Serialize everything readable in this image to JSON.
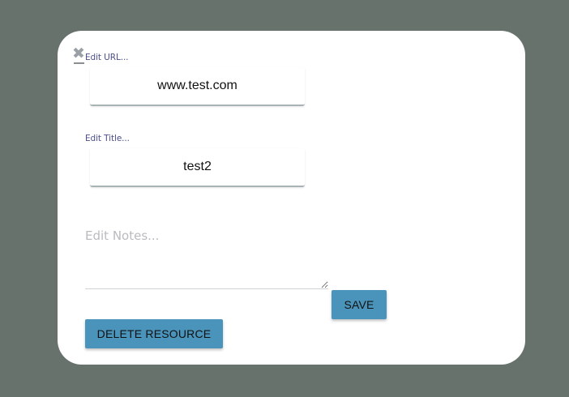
{
  "modal": {
    "close_glyph": "✖",
    "url": {
      "label": "Edit URL...",
      "value": "www.test.com"
    },
    "title": {
      "label": "Edit Title...",
      "value": "test2"
    },
    "notes": {
      "placeholder": "Edit Notes...",
      "value": ""
    },
    "save_label": "SAVE",
    "delete_label": "DELETE RESOURCE"
  },
  "colors": {
    "backdrop": "#67726c",
    "modal_background": "#ffffff",
    "label_text": "#4c4e8a",
    "button_background": "#4a94bb",
    "close_icon": "#9aa0a6"
  }
}
